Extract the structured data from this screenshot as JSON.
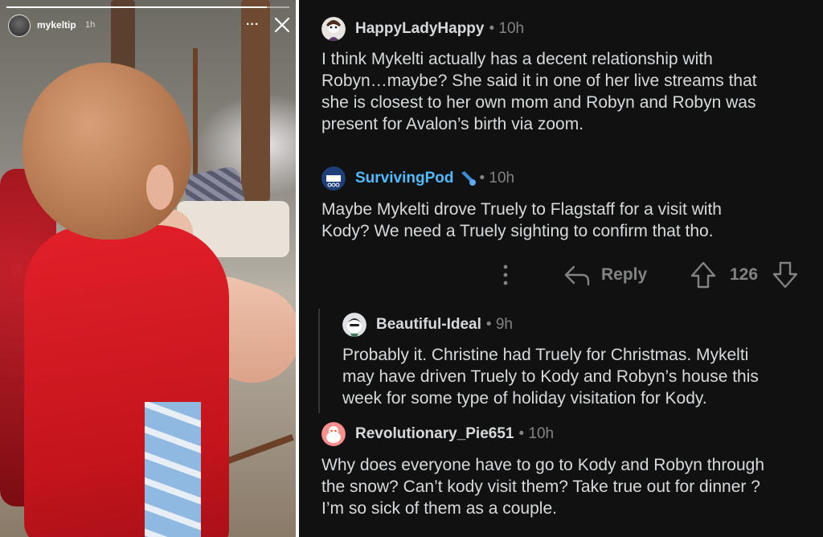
{
  "story": {
    "username": "mykeltip",
    "time": "1h",
    "more_label": "...",
    "progress": 0.92
  },
  "comments": [
    {
      "username": "HappyLadyHappy",
      "time": "• 10h",
      "text_lines": [
        "I think Mykelti actually has a decent relationship with",
        "Robyn…maybe? She said it in one of her live streams that",
        "she is closest to her own mom and Robyn and Robyn was",
        "present for Avalon’s birth via zoom."
      ]
    },
    {
      "username": "SurvivingPod",
      "time": "• 10h",
      "text_lines": [
        "Maybe Mykelti drove Truely to Flagstaff for a visit with",
        "Kody? We need a Truely sighting to confirm that tho."
      ],
      "actions": {
        "reply_label": "Reply",
        "vote_count": "126"
      }
    },
    {
      "username": "Beautiful-Ideal",
      "time": "• 9h",
      "text_lines": [
        "Probably it.  Christine had Truely for Christmas. Mykelti",
        "may have driven Truely to Kody and Robyn’s house this",
        "week for some type of holiday visitation for Kody."
      ]
    },
    {
      "username": "Revolutionary_Pie651",
      "time": "• 10h",
      "text_lines": [
        "Why does everyone have to go to Kody and Robyn through",
        "the snow? Can’t kody visit them? Take true out for dinner ?",
        "I’m so sick of them as a couple."
      ]
    }
  ],
  "colors": {
    "thread_bg": "#111111",
    "text": "#d7dadc",
    "muted": "#818384",
    "highlight_user": "#4fbcff",
    "snoo_pink": "#ff8e8e"
  }
}
